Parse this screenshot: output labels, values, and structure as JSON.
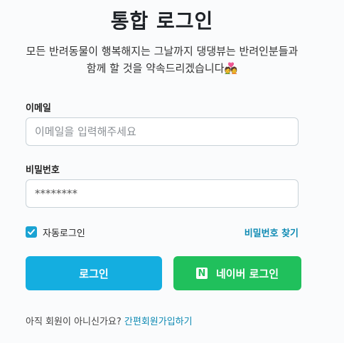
{
  "page": {
    "title": "통합 로그인",
    "subtitle_line1": "모든 반려동물이 행복해지는 그날까지 댕댕뷰는 반려인분들과",
    "subtitle_line2": "함께 할 것을 약속드리겠습니다",
    "subtitle_emoji": "💑",
    "accent_color": "#14aee0",
    "naver_color": "#20c05c",
    "link_color": "#0e8ab3"
  },
  "form": {
    "email_label": "이메일",
    "email_placeholder": "이메일을 입력해주세요",
    "email_value": "",
    "password_label": "비밀번호",
    "password_value": "********",
    "auto_login_label": "자동로그인",
    "auto_login_checked": true,
    "checkbox_icon": "check-icon",
    "find_password": "비밀번호 찾기"
  },
  "buttons": {
    "login": "로그인",
    "naver_login": "네이버 로그인",
    "naver_icon": "naver-n-icon",
    "naver_icon_glyph": "N"
  },
  "signup": {
    "prompt": "아직 회원이 아니신가요?",
    "link": "간편회원가입하기"
  }
}
